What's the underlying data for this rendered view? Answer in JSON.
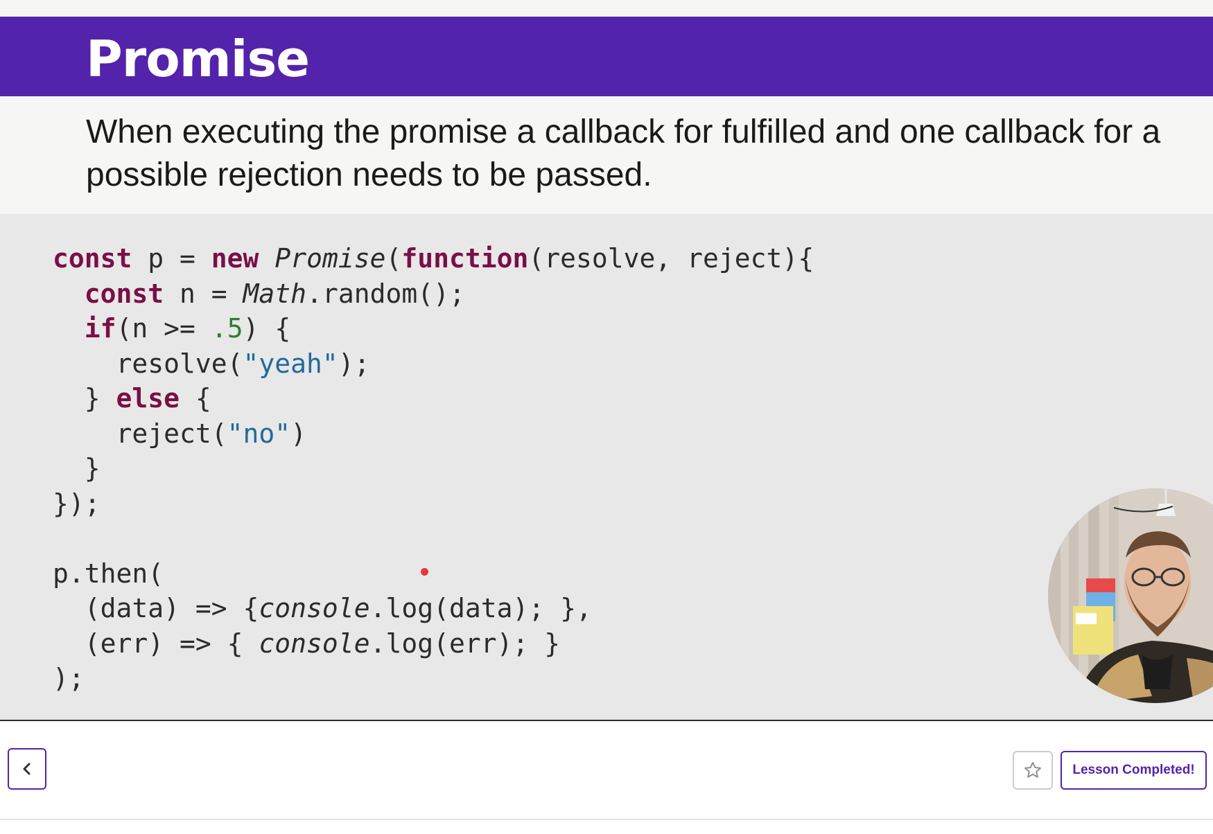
{
  "slide": {
    "title": "Promise",
    "description": "When executing the promise a callback for fulfilled and one callback for a possible rejection needs to be passed."
  },
  "code": {
    "line1": {
      "kw1": "const",
      "t1": " p = ",
      "kw2": "new",
      "t2": " ",
      "it1": "Promise",
      "t3": "(",
      "kw3": "function",
      "t4": "(resolve, reject){"
    },
    "line2": {
      "t0": "  ",
      "kw1": "const",
      "t1": " n = ",
      "it1": "Math",
      "t2": ".random();"
    },
    "line3": {
      "t0": "  ",
      "kw1": "if",
      "t1": "(n >= ",
      "num1": ".5",
      "t2": ") {"
    },
    "line4": {
      "t0": "    resolve(",
      "str1": "\"yeah\"",
      "t1": ");"
    },
    "line5": {
      "t0": "  } ",
      "kw1": "else",
      "t1": " {"
    },
    "line6": {
      "t0": "    reject(",
      "str1": "\"no\"",
      "t1": ")"
    },
    "line7": {
      "t0": "  }"
    },
    "line8": {
      "t0": "});"
    },
    "line10": {
      "t0": "p.then("
    },
    "line11": {
      "t0": "  (data) => {",
      "it1": "console",
      "t1": ".log(data); },"
    },
    "line12": {
      "t0": "  (err) => { ",
      "it1": "console",
      "t1": ".log(err); }"
    },
    "line13": {
      "t0": ");"
    }
  },
  "footer": {
    "lesson_button_label": "Lesson Completed!"
  },
  "icons": {
    "back": "chevron-left-icon",
    "favorite": "star-outline-icon"
  },
  "colors": {
    "accent": "#5423ab",
    "keyword": "#7a0f45",
    "string": "#24699b",
    "number": "#2e7d32",
    "code_background": "#e8e8e8",
    "pointer": "#e53935"
  }
}
